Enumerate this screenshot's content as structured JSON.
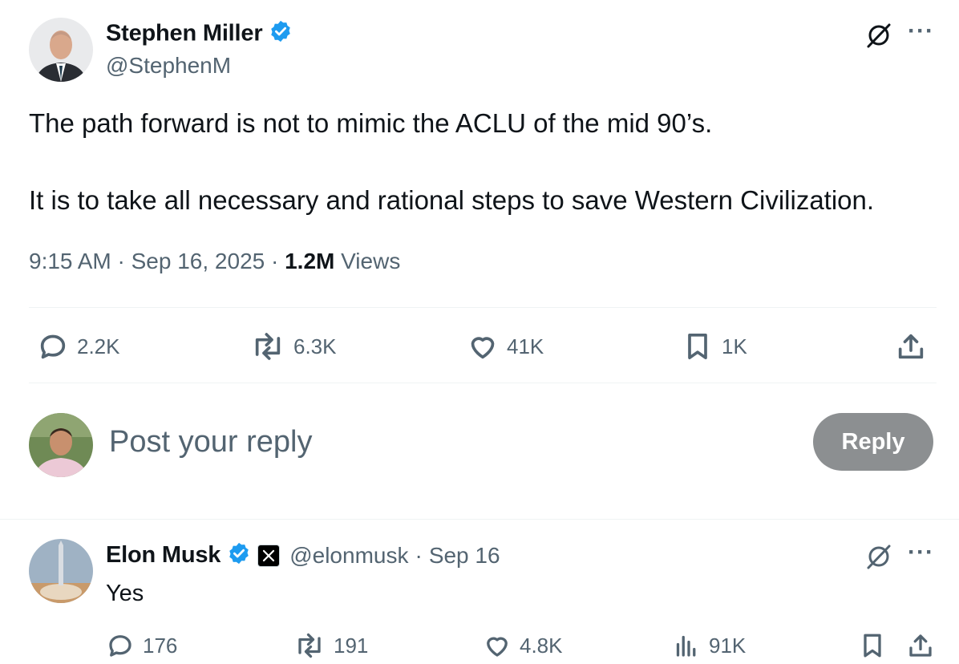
{
  "post": {
    "author_name": "Stephen Miller",
    "author_handle": "@StephenM",
    "text_line1": "The path forward is not to mimic the ACLU of the mid 90’s.",
    "text_line2": "It is to take all necessary and rational steps to save Western Civilization.",
    "time": "9:15 AM",
    "date": "Sep 16, 2025",
    "views_count": "1.2M",
    "views_label": "Views",
    "replies": "2.2K",
    "reposts": "6.3K",
    "likes": "41K",
    "bookmarks": "1K"
  },
  "composer": {
    "placeholder": "Post your reply",
    "button_label": "Reply"
  },
  "reply": {
    "author_name": "Elon Musk",
    "author_handle": "@elonmusk",
    "date": "Sep 16",
    "text": "Yes",
    "replies": "176",
    "reposts": "191",
    "likes": "4.8K",
    "views": "91K"
  },
  "colors": {
    "verified": "#1d9bf0",
    "muted_text": "#536471",
    "reply_button": "#8c8f91"
  },
  "icons": [
    "grok-icon",
    "more-icon",
    "reply-icon",
    "repost-icon",
    "like-icon",
    "bookmark-icon",
    "share-icon",
    "views-icon",
    "verified-badge-icon",
    "x-affiliate-icon"
  ]
}
